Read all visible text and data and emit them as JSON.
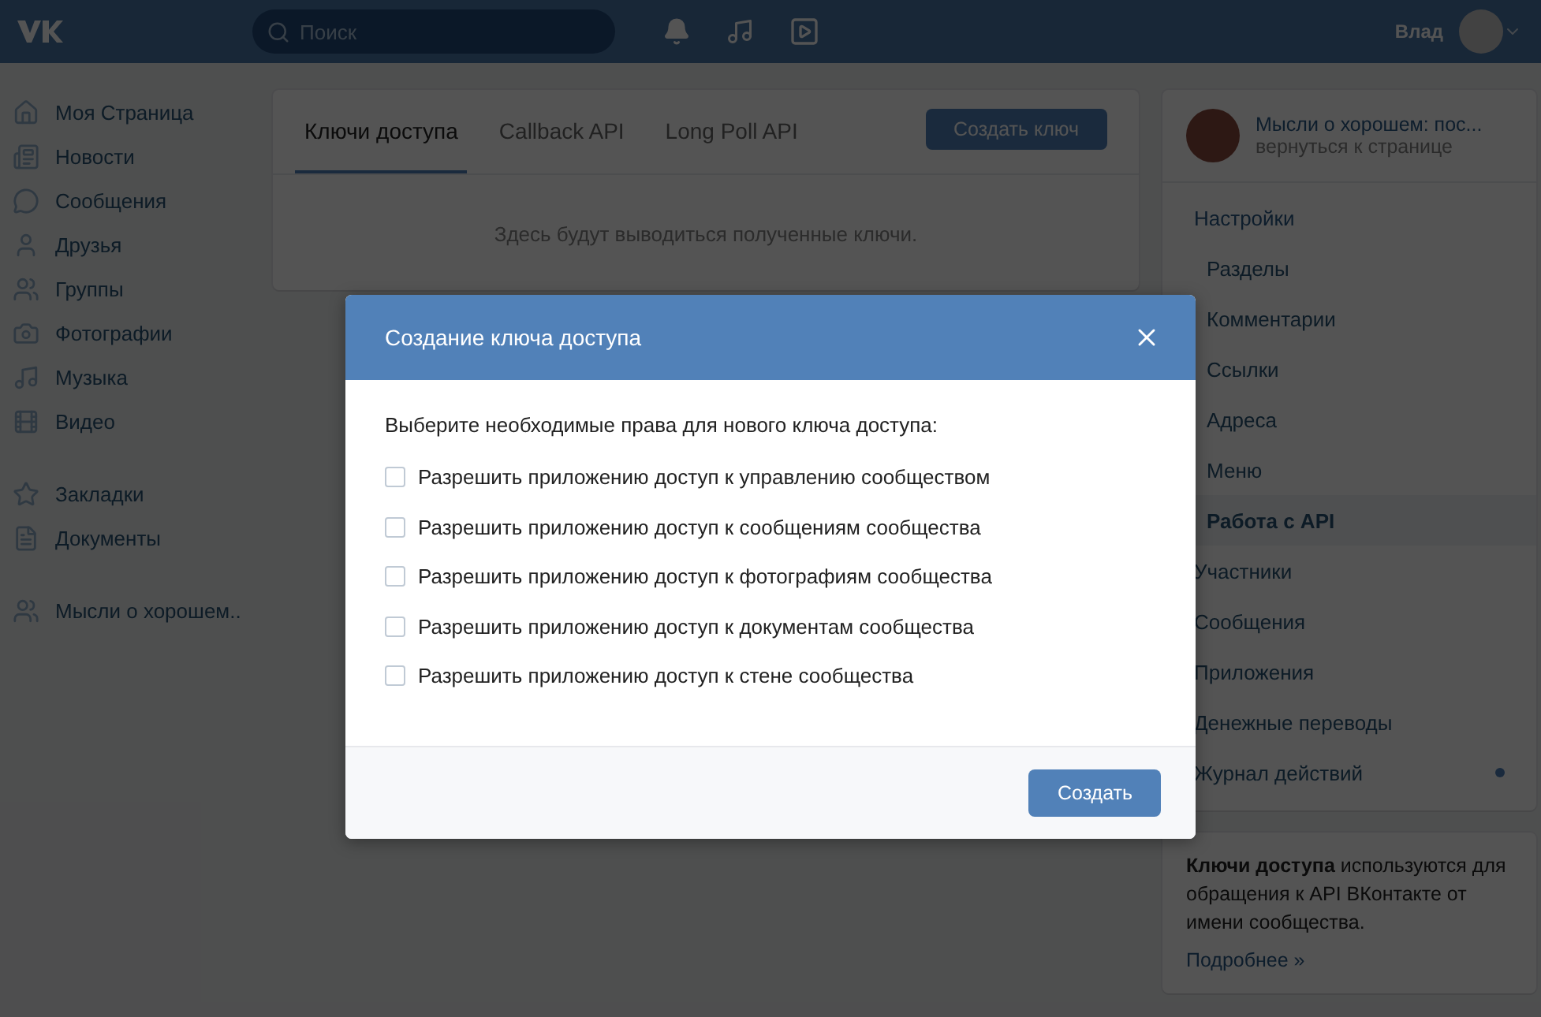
{
  "header": {
    "search": {
      "placeholder": "Поиск"
    },
    "user_name": "Влад"
  },
  "sidebar": {
    "groups": [
      {
        "items": [
          {
            "label": "Моя Страница"
          },
          {
            "label": "Новости"
          },
          {
            "label": "Сообщения"
          },
          {
            "label": "Друзья"
          },
          {
            "label": "Группы"
          },
          {
            "label": "Фотографии"
          },
          {
            "label": "Музыка"
          },
          {
            "label": "Видео"
          }
        ]
      },
      {
        "items": [
          {
            "label": "Закладки"
          },
          {
            "label": "Документы"
          }
        ]
      },
      {
        "items": [
          {
            "label": "Мысли о хорошем.."
          }
        ]
      }
    ]
  },
  "main": {
    "tabs": [
      {
        "label": "Ключи доступа",
        "selected": true
      },
      {
        "label": "Callback API",
        "selected": false
      },
      {
        "label": "Long Poll API",
        "selected": false
      }
    ],
    "create_button": "Создать ключ",
    "empty_text": "Здесь будут выводиться полученные ключи."
  },
  "community": {
    "name": "Мысли о хорошем: пос...",
    "back_link": "вернуться к странице",
    "menu": [
      {
        "label": "Настройки",
        "selected": false,
        "dot": false,
        "children": [
          {
            "label": "Разделы",
            "selected": false
          },
          {
            "label": "Комментарии",
            "selected": false
          },
          {
            "label": "Ссылки",
            "selected": false
          },
          {
            "label": "Адреса",
            "selected": false
          },
          {
            "label": "Меню",
            "selected": false
          },
          {
            "label": "Работа с API",
            "selected": true
          }
        ]
      },
      {
        "label": "Участники",
        "selected": false,
        "dot": false
      },
      {
        "label": "Сообщения",
        "selected": false,
        "dot": false
      },
      {
        "label": "Приложения",
        "selected": false,
        "dot": false
      },
      {
        "label": "Денежные переводы",
        "selected": false,
        "dot": false
      },
      {
        "label": "Журнал действий",
        "selected": false,
        "dot": true
      }
    ]
  },
  "info": {
    "text": "**Ключи доступа** используются для обращения к API ВКонтакте от имени сообщества.",
    "link": "Подробнее »"
  },
  "modal": {
    "title": "Создание ключа доступа",
    "intro": "Выберите необходимые права для нового ключа доступа:",
    "options": [
      {
        "label": "Разрешить приложению доступ к управлению сообществом",
        "checked": false
      },
      {
        "label": "Разрешить приложению доступ к сообщениям сообщества",
        "checked": false
      },
      {
        "label": "Разрешить приложению доступ к фотографиям сообщества",
        "checked": false
      },
      {
        "label": "Разрешить приложению доступ к документам сообщества",
        "checked": false
      },
      {
        "label": "Разрешить приложению доступ к стене сообщества",
        "checked": false
      }
    ],
    "submit": "Создать"
  }
}
